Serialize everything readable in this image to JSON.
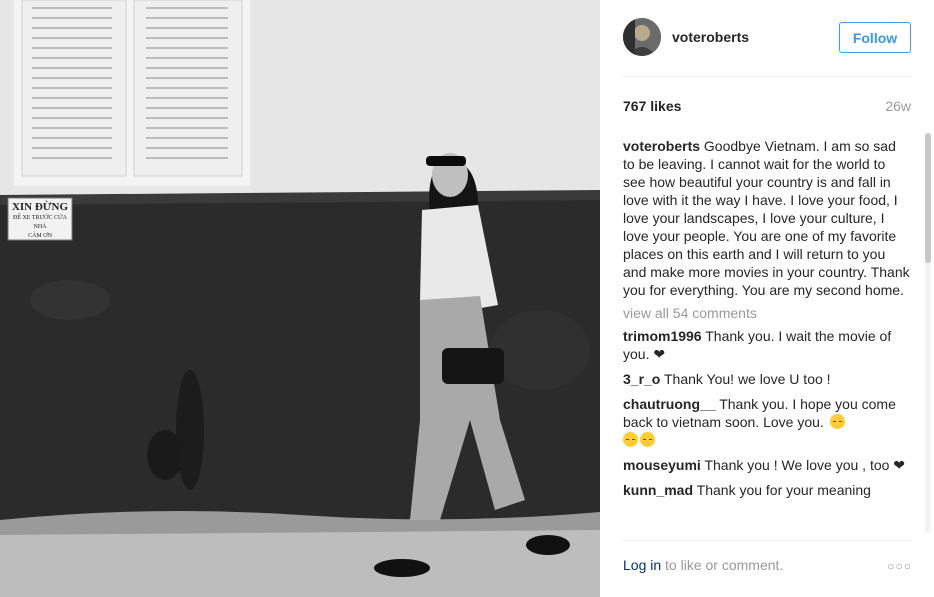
{
  "post": {
    "username": "voteroberts",
    "follow_label": "Follow",
    "likes": "767 likes",
    "age": "26w",
    "caption_user": "voteroberts",
    "caption_text": "Goodbye Vietnam. I am so sad to be leaving. I cannot wait for the world to see how beautiful your country is and fall in love with it the way I have. I love your food, I love your landscapes, I love your culture, I love your people. You are one of my favorite places on this earth and I will return to you and make more movies in your country. Thank you for everything. You are my second home.",
    "view_all": "view all 54 comments",
    "comments": [
      {
        "user": "trimom1996",
        "text": "Thank you. I wait the movie of you. ❤"
      },
      {
        "user": "3_r_o",
        "text": "Thank You! we love U too !"
      },
      {
        "user": "chautruong__",
        "text": "Thank you. I hope you come back to vietnam soon. Love you."
      },
      {
        "user": "mouseyumi",
        "text": "Thank you ! We love you , too ❤"
      },
      {
        "user": "kunn_mad",
        "text": "Thank you for your meaning"
      }
    ]
  },
  "photo": {
    "sign_line1": "XIN ĐỪNG",
    "sign_line2": "ĐỂ XE TRƯỚC CỬA NHÀ",
    "sign_line3": "CÁM ƠN"
  },
  "footer": {
    "login_link": "Log in",
    "login_rest": " to like or comment.",
    "more": "○○○"
  }
}
